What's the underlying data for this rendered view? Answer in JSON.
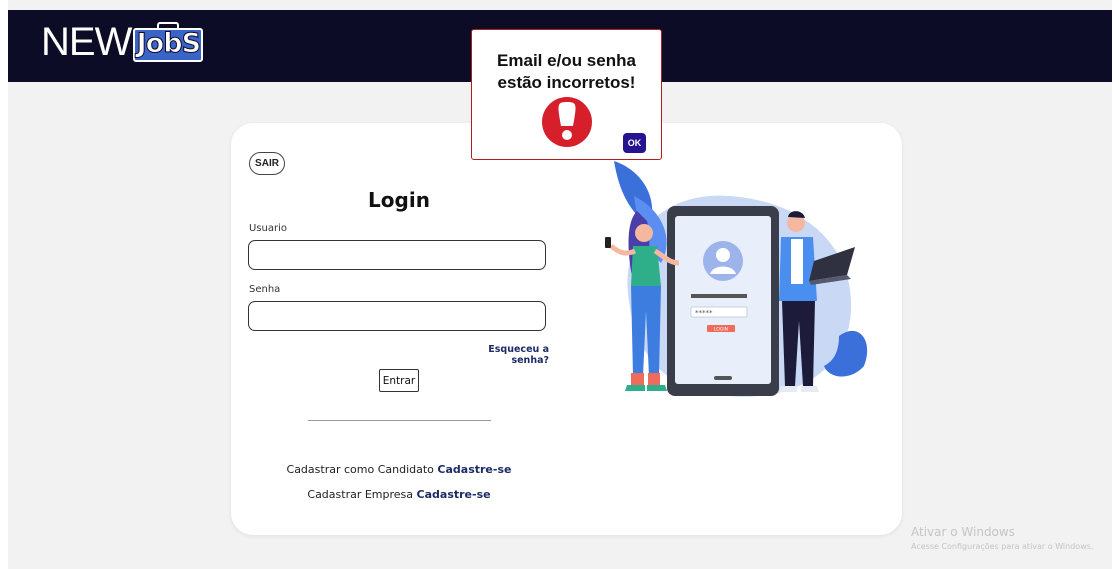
{
  "header": {
    "logo_new": "NEW",
    "logo_jobs": "JobS"
  },
  "login": {
    "exit_label": "SAIR",
    "title": "Login",
    "username_label": "Usuario",
    "username_value": "",
    "password_label": "Senha",
    "password_value": "",
    "forgot_label": "Esqueceu a senha?",
    "submit_label": "Entrar"
  },
  "register": {
    "candidate_text": "Cadastrar como Candidato",
    "candidate_link": "Cadastre-se",
    "company_text": "Cadastrar Empresa",
    "company_link": "Cadastre-se"
  },
  "illustration": {
    "login_button_text": "LOGIN",
    "password_dots": "*****"
  },
  "alert": {
    "message_line1": "Email e/ou senha",
    "message_line2": "estão incorretos!",
    "icon": "exclamation-icon",
    "ok_label": "OK"
  },
  "watermark": {
    "title": "Ativar o Windows",
    "subtitle": "Acesse Configurações para ativar o Windows."
  },
  "colors": {
    "header_bg": "#0d0c27",
    "link": "#1c2b66",
    "alert_border": "#b71c1c",
    "alert_icon": "#d61f2b",
    "ok_button": "#25138f",
    "illustration_blob": "#c9d9f5"
  }
}
